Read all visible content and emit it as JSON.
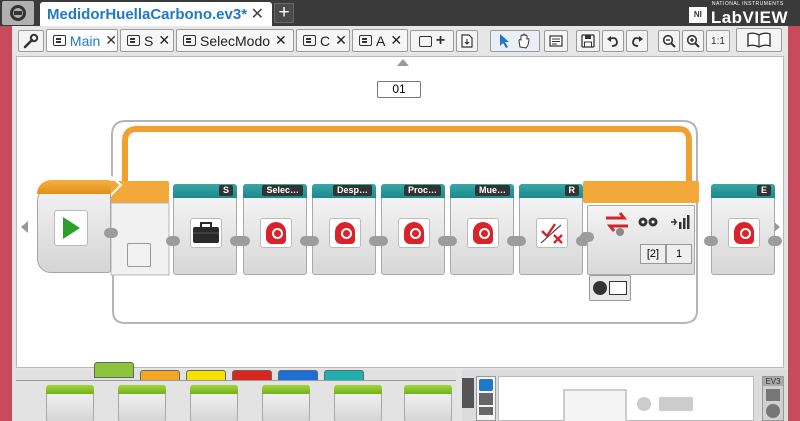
{
  "title_bar": {
    "project_name": "MedidorHuellaCarbono.ev3*",
    "close_glyph": "✕",
    "add_glyph": "+",
    "brand_small": "NATIONAL INSTRUMENTS",
    "brand_ni": "NI",
    "brand_name": "LabVIEW"
  },
  "tabs": [
    {
      "label": "Main",
      "active": true
    },
    {
      "label": "S",
      "active": false
    },
    {
      "label": "SelecModo",
      "active": false
    },
    {
      "label": "C",
      "active": false
    },
    {
      "label": "A",
      "active": false
    }
  ],
  "toolbar": {
    "zoom_reset": "1:1"
  },
  "loop": {
    "label": "01"
  },
  "blocks": [
    {
      "label": "",
      "kind": "start"
    },
    {
      "label": "S",
      "kind": "briefcase"
    },
    {
      "label": "Selec…",
      "kind": "myblock"
    },
    {
      "label": "Desp…",
      "kind": "myblock"
    },
    {
      "label": "Proc…",
      "kind": "myblock"
    },
    {
      "label": "Mue…",
      "kind": "myblock"
    },
    {
      "label": "R",
      "kind": "compare"
    },
    {
      "label": "",
      "kind": "switch"
    },
    {
      "label": "E",
      "kind": "myblock"
    }
  ],
  "switch_params": {
    "port": "[2]",
    "value": "1"
  },
  "palette_tab_colors": [
    "#8cc43c",
    "#f5a623",
    "#f5e100",
    "#d9261c",
    "#1c6fd9",
    "#1fb0b0"
  ],
  "hw_panel": {
    "brick_label": "EV3"
  },
  "colors": {
    "loop_orange": "#f0a030",
    "block_teal": "#1b8a8c",
    "frame_red": "#c94a5a",
    "accent_blue": "#1f79c9",
    "start_green": "#2aa12a"
  }
}
